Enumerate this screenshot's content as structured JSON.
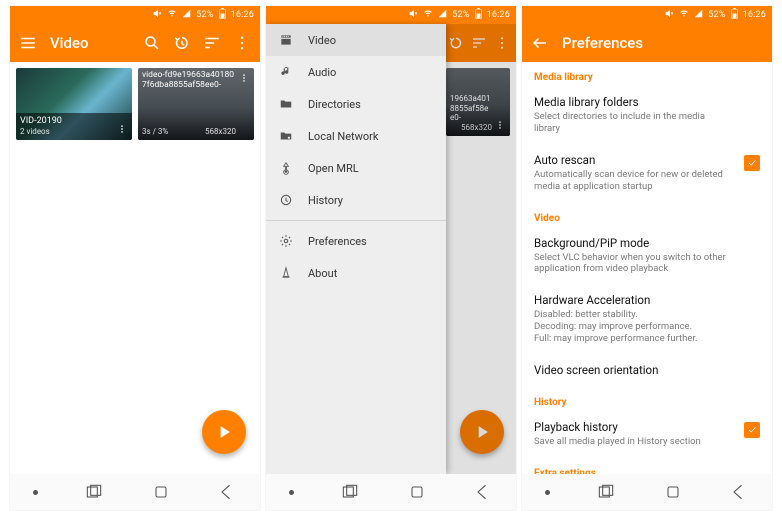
{
  "status": {
    "battery": "52%",
    "time": "16:26"
  },
  "screen1": {
    "title": "Video",
    "videos": [
      {
        "filename": "VID-20190",
        "meta_left": "2 videos",
        "meta_right": ""
      },
      {
        "filename": "video-fd9e19663a401807f6dba8855af58ee0-",
        "meta_left": "3s / 3%",
        "meta_right": "568x320"
      }
    ]
  },
  "screen2": {
    "drawer": [
      {
        "icon": "video",
        "label": "Video",
        "selected": true
      },
      {
        "icon": "audio",
        "label": "Audio",
        "selected": false
      },
      {
        "icon": "folder",
        "label": "Directories",
        "selected": false
      },
      {
        "icon": "lan",
        "label": "Local Network",
        "selected": false
      },
      {
        "icon": "mrl",
        "label": "Open MRL",
        "selected": false
      },
      {
        "icon": "history",
        "label": "History",
        "selected": false
      },
      {
        "icon": "settings",
        "label": "Preferences",
        "selected": false
      },
      {
        "icon": "about",
        "label": "About",
        "selected": false
      }
    ],
    "peek_video": {
      "filename": "19663a401 8855af58ee0-",
      "meta_right": "568x320"
    }
  },
  "screen3": {
    "title": "Preferences",
    "sections": {
      "media_library_heading": "Media library",
      "media_folders_title": "Media library folders",
      "media_folders_sub": "Select directories to include in the media library",
      "auto_rescan_title": "Auto rescan",
      "auto_rescan_sub": "Automatically scan device for new or deleted media at application startup",
      "video_heading": "Video",
      "bg_title": "Background/PiP mode",
      "bg_sub": "Select VLC behavior when you switch to other application from video playback",
      "hw_title": "Hardware Acceleration",
      "hw_sub": "Disabled: better stability.\nDecoding: may improve performance.\nFull: may improve performance further.",
      "orient_title": "Video screen orientation",
      "history_heading": "History",
      "pb_history_title": "Playback history",
      "pb_history_sub": "Save all media played in History section",
      "extra_heading": "Extra settings"
    }
  }
}
